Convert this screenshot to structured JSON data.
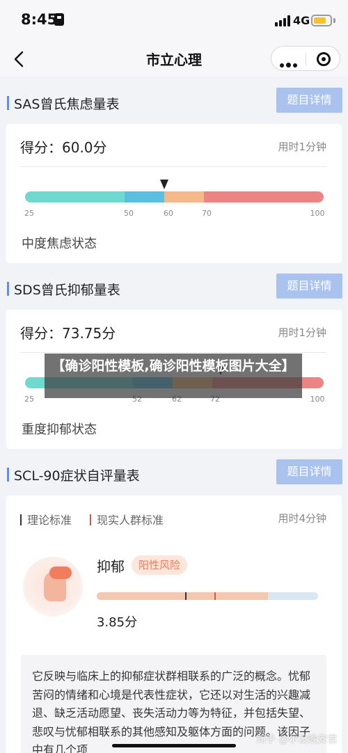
{
  "status_bar": {
    "time": "8:45",
    "network": "4G"
  },
  "nav": {
    "title": "市立心理"
  },
  "sections": [
    {
      "title": "SAS曾氏焦虑量表",
      "detail_button": "题目详情",
      "score_label": "得分：60.0分",
      "duration": "用时1分钟",
      "ticks": [
        "25",
        "50",
        "60",
        "70",
        "100"
      ],
      "score_value": 60,
      "state": "中度焦虑状态"
    },
    {
      "title": "SDS曾氏抑郁量表",
      "detail_button": "题目详情",
      "score_label": "得分：73.75分",
      "duration": "用时1分钟",
      "ticks": [
        "25",
        "52",
        "62",
        "72",
        "100"
      ],
      "score_value": 73.75,
      "state": "重度抑郁状态"
    },
    {
      "title": "SCL-90症状自评量表",
      "detail_button": "题目详情",
      "legend_theory": "理论标准",
      "legend_real": "现实人群标准",
      "duration": "用时4分钟",
      "symptom": "抑郁",
      "risk": "阳性风险",
      "symptom_score": "3.85分",
      "description": "它反映与临床上的抑郁症状群相联系的广泛的概念。忧郁苦闷的情绪和心境是代表性症状，它还以对生活的兴趣减退、缺乏活动愿望、丧失活动力等为特征，并包括失望、悲叹与忧郁相联系的其他感知及躯体方面的问题。该因子中有几个项"
    }
  ],
  "overlay": "【确诊阳性模板,确诊阳性模板图片大全】",
  "watermark": "知乎 @尔没晚安君",
  "colors": {
    "accent": "#5a8ff0",
    "button": "#a9c2ee",
    "scale_normal": "#6fd9cf",
    "scale_mild": "#5bbfe0",
    "scale_moderate": "#f4b98a",
    "scale_severe": "#ec8484",
    "risk": "#ef7a54"
  }
}
